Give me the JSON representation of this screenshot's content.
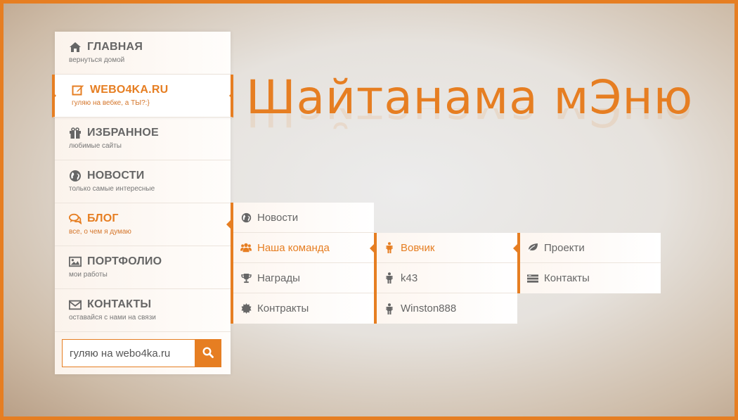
{
  "page": {
    "title": "Шайтанама мЭню"
  },
  "sidebar": {
    "items": [
      {
        "label": "ГЛАВНАЯ",
        "sub": "вернуться домой",
        "icon": "home-icon"
      },
      {
        "label": "WEBO4KA.RU",
        "sub": "гуляю на вебке, а ТЫ?:}",
        "icon": "edit-icon"
      },
      {
        "label": "ИЗБРАННОЕ",
        "sub": "любимые сайты",
        "icon": "gift-icon"
      },
      {
        "label": "НОВОСТИ",
        "sub": "только самые интересные",
        "icon": "globe-icon"
      },
      {
        "label": "БЛОГ",
        "sub": "все, о чем я думаю",
        "icon": "comments-icon"
      },
      {
        "label": "ПОРТФОЛИО",
        "sub": "мои работы",
        "icon": "picture-icon"
      },
      {
        "label": "КОНТАКТЫ",
        "sub": "оставайся с нами на связи",
        "icon": "envelope-icon"
      }
    ]
  },
  "search": {
    "value": "гуляю на webo4ka.ru",
    "button_icon": "search-icon"
  },
  "submenu1": {
    "items": [
      {
        "label": "Новости",
        "icon": "globe-icon"
      },
      {
        "label": "Наша команда",
        "icon": "group-icon"
      },
      {
        "label": "Награды",
        "icon": "trophy-icon"
      },
      {
        "label": "Контракты",
        "icon": "certificate-icon"
      }
    ]
  },
  "submenu2": {
    "items": [
      {
        "label": "Вовчик",
        "icon": "user-icon"
      },
      {
        "label": "k43",
        "icon": "user-icon"
      },
      {
        "label": "Winston888",
        "icon": "user-icon"
      }
    ]
  },
  "submenu3": {
    "items": [
      {
        "label": "Проекти",
        "icon": "leaf-icon"
      },
      {
        "label": "Контакты",
        "icon": "card-icon"
      }
    ]
  },
  "colors": {
    "accent": "#e67e22",
    "text": "#666666"
  }
}
